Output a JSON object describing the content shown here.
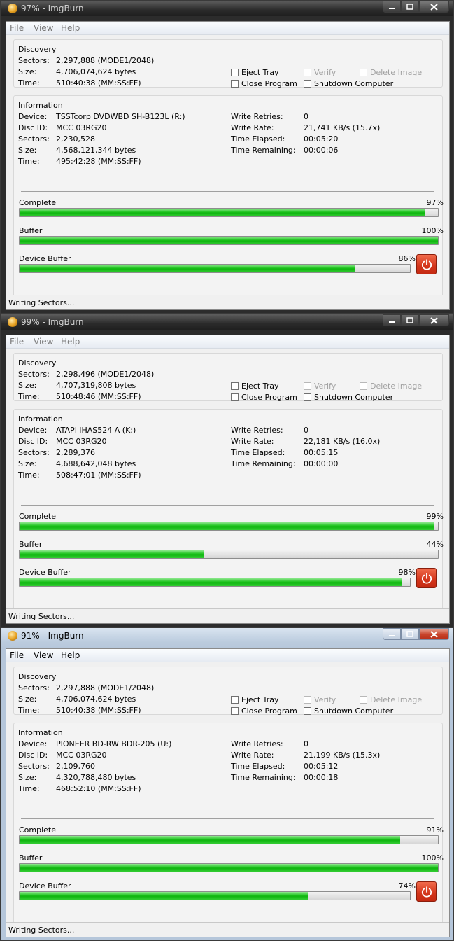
{
  "windows": [
    {
      "title": "97% - ImgBurn",
      "theme": "dark",
      "menu": [
        "File",
        "View",
        "Help"
      ],
      "discovery": {
        "title": "Discovery",
        "sectors_label": "Sectors:",
        "sectors": "2,297,888 (MODE1/2048)",
        "size_label": "Size:",
        "size": "4,706,074,624 bytes",
        "time_label": "Time:",
        "time": "510:40:38 (MM:SS:FF)"
      },
      "options": {
        "eject_tray": "Eject Tray",
        "close_program": "Close Program",
        "verify": "Verify",
        "shutdown": "Shutdown Computer",
        "delete_image": "Delete Image"
      },
      "information": {
        "title": "Information",
        "device_label": "Device:",
        "device": "TSSTcorp DVDWBD SH-B123L (R:)",
        "disc_id_label": "Disc ID:",
        "disc_id": "MCC 03RG20",
        "sectors_label": "Sectors:",
        "sectors": "2,230,528",
        "size_label": "Size:",
        "size": "4,568,121,344 bytes",
        "time_label": "Time:",
        "time": "495:42:28 (MM:SS:FF)",
        "write_retries_label": "Write Retries:",
        "write_retries": "0",
        "write_rate_label": "Write Rate:",
        "write_rate": "21,741 KB/s (15.7x)",
        "time_elapsed_label": "Time Elapsed:",
        "time_elapsed": "00:05:20",
        "time_remaining_label": "Time Remaining:",
        "time_remaining": "00:00:06"
      },
      "progress": {
        "complete_label": "Complete",
        "complete_pct": "97%",
        "complete": 97,
        "buffer_label": "Buffer",
        "buffer_pct": "100%",
        "buffer": 100,
        "device_buffer_label": "Device Buffer",
        "device_buffer_pct": "86%",
        "device_buffer": 86
      },
      "status": "Writing Sectors..."
    },
    {
      "title": "99% - ImgBurn",
      "theme": "dark",
      "menu": [
        "File",
        "View",
        "Help"
      ],
      "discovery": {
        "title": "Discovery",
        "sectors_label": "Sectors:",
        "sectors": "2,298,496 (MODE1/2048)",
        "size_label": "Size:",
        "size": "4,707,319,808 bytes",
        "time_label": "Time:",
        "time": "510:48:46 (MM:SS:FF)"
      },
      "options": {
        "eject_tray": "Eject Tray",
        "close_program": "Close Program",
        "verify": "Verify",
        "shutdown": "Shutdown Computer",
        "delete_image": "Delete Image"
      },
      "information": {
        "title": "Information",
        "device_label": "Device:",
        "device": "ATAPI iHAS524 A (K:)",
        "disc_id_label": "Disc ID:",
        "disc_id": "MCC 03RG20",
        "sectors_label": "Sectors:",
        "sectors": "2,289,376",
        "size_label": "Size:",
        "size": "4,688,642,048 bytes",
        "time_label": "Time:",
        "time": "508:47:01 (MM:SS:FF)",
        "write_retries_label": "Write Retries:",
        "write_retries": "0",
        "write_rate_label": "Write Rate:",
        "write_rate": "22,181 KB/s (16.0x)",
        "time_elapsed_label": "Time Elapsed:",
        "time_elapsed": "00:05:15",
        "time_remaining_label": "Time Remaining:",
        "time_remaining": "00:00:00"
      },
      "progress": {
        "complete_label": "Complete",
        "complete_pct": "99%",
        "complete": 99,
        "buffer_label": "Buffer",
        "buffer_pct": "44%",
        "buffer": 44,
        "device_buffer_label": "Device Buffer",
        "device_buffer_pct": "98%",
        "device_buffer": 98
      },
      "status": "Writing Sectors..."
    },
    {
      "title": "91% - ImgBurn",
      "theme": "light",
      "menu": [
        "File",
        "View",
        "Help"
      ],
      "discovery": {
        "title": "Discovery",
        "sectors_label": "Sectors:",
        "sectors": "2,297,888 (MODE1/2048)",
        "size_label": "Size:",
        "size": "4,706,074,624 bytes",
        "time_label": "Time:",
        "time": "510:40:38 (MM:SS:FF)"
      },
      "options": {
        "eject_tray": "Eject Tray",
        "close_program": "Close Program",
        "verify": "Verify",
        "shutdown": "Shutdown Computer",
        "delete_image": "Delete Image"
      },
      "information": {
        "title": "Information",
        "device_label": "Device:",
        "device": "PIONEER BD-RW BDR-205 (U:)",
        "disc_id_label": "Disc ID:",
        "disc_id": "MCC 03RG20",
        "sectors_label": "Sectors:",
        "sectors": "2,109,760",
        "size_label": "Size:",
        "size": "4,320,788,480 bytes",
        "time_label": "Time:",
        "time": "468:52:10 (MM:SS:FF)",
        "write_retries_label": "Write Retries:",
        "write_retries": "0",
        "write_rate_label": "Write Rate:",
        "write_rate": "21,199 KB/s (15.3x)",
        "time_elapsed_label": "Time Elapsed:",
        "time_elapsed": "00:05:12",
        "time_remaining_label": "Time Remaining:",
        "time_remaining": "00:00:18"
      },
      "progress": {
        "complete_label": "Complete",
        "complete_pct": "91%",
        "complete": 91,
        "buffer_label": "Buffer",
        "buffer_pct": "100%",
        "buffer": 100,
        "device_buffer_label": "Device Buffer",
        "device_buffer_pct": "74%",
        "device_buffer": 74
      },
      "status": "Writing Sectors..."
    }
  ],
  "icons": {
    "app": "imgburn-disc-icon",
    "minimize": "minimize-icon",
    "maximize": "maximize-icon",
    "close": "close-icon",
    "stop": "power-stop-icon"
  },
  "colors": {
    "progress_fill": "#1fc41f",
    "stop_button": "#d3351b",
    "client_bg": "#f0f0f0"
  }
}
